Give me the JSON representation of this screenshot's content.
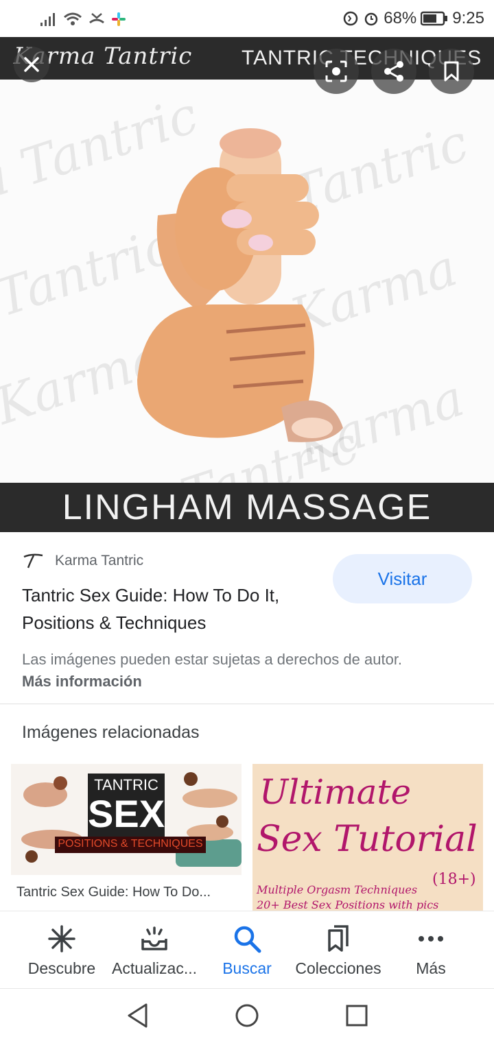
{
  "status_bar": {
    "battery": "68%",
    "time": "9:25"
  },
  "hero": {
    "brand": "Karma Tantric",
    "top_caption": "TANTRIC TECHNIQUES",
    "bottom_caption": "LINGHAM MASSAGE"
  },
  "result": {
    "source": "Karma Tantric",
    "title": "Tantric Sex Guide: How To Do It, Positions & Techniques",
    "visit_label": "Visitar",
    "copyright": "Las imágenes pueden estar sujetas a derechos de autor.",
    "more_info": "Más información"
  },
  "related": {
    "heading": "Imágenes relacionadas",
    "cards": [
      {
        "image_text_1": "TANTRIC",
        "image_text_2": "SEX",
        "image_text_3": "POSITIONS & TECHNIQUES",
        "caption": "Tantric Sex Guide: How To Do..."
      },
      {
        "image_text_1": "Ultimate",
        "image_text_2": "Sex Tutorial",
        "image_text_3": "(18+)",
        "image_text_4": "Multiple Orgasm Techniques",
        "image_text_5": "20+ Best Sex Positions with pics"
      }
    ]
  },
  "bottom_nav": [
    {
      "label": "Descubre",
      "icon": "asterisk-icon"
    },
    {
      "label": "Actualizac...",
      "icon": "updates-tray-icon"
    },
    {
      "label": "Buscar",
      "icon": "search-icon",
      "active": true
    },
    {
      "label": "Colecciones",
      "icon": "collections-icon"
    },
    {
      "label": "Más",
      "icon": "more-dots-icon"
    }
  ],
  "colors": {
    "accent": "#1a73e8",
    "visit_bg": "#e8f0fe",
    "hero_band": "#2b2b2b",
    "card_text": "#b1166b"
  }
}
